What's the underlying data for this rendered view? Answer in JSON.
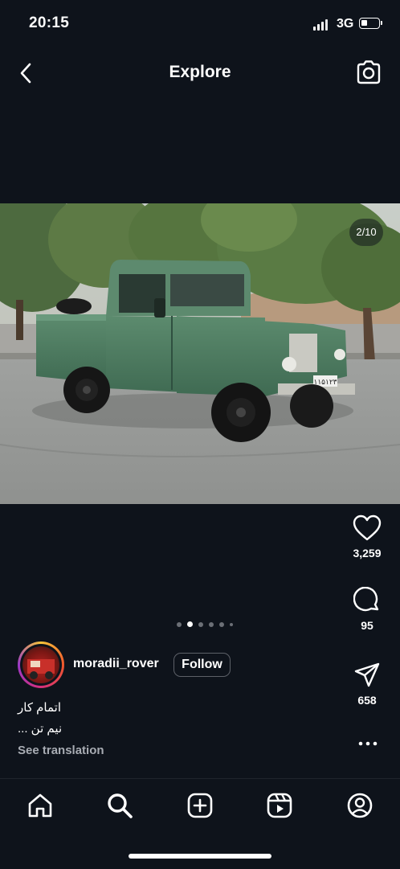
{
  "status_bar": {
    "time": "20:15",
    "network": "3G",
    "battery_level": 0.3
  },
  "header": {
    "title": "Explore",
    "back_icon": "chevron-left-icon",
    "camera_icon": "camera-icon"
  },
  "post": {
    "image_counter": "2/10",
    "carousel": {
      "count": 6,
      "active_index": 1
    },
    "likes": "3,259",
    "comments": "95",
    "shares": "658",
    "author": {
      "username": "moradii_rover",
      "follow_label": "Follow"
    },
    "caption_line_1": "اتمام کار",
    "caption_line_2": "نیم تن ...",
    "see_translation": "See translation",
    "plate_text": "۱۱۵۱۲۳"
  },
  "nav": {
    "items": [
      {
        "name": "home",
        "icon": "home-icon"
      },
      {
        "name": "search",
        "icon": "search-icon"
      },
      {
        "name": "create",
        "icon": "plus-square-icon"
      },
      {
        "name": "reels",
        "icon": "reels-icon"
      },
      {
        "name": "profile",
        "icon": "profile-icon"
      }
    ]
  },
  "colors": {
    "background": "#0e131b",
    "vehicle_green": "#4c7a5e",
    "avatar_ring": "#d62f7a"
  }
}
